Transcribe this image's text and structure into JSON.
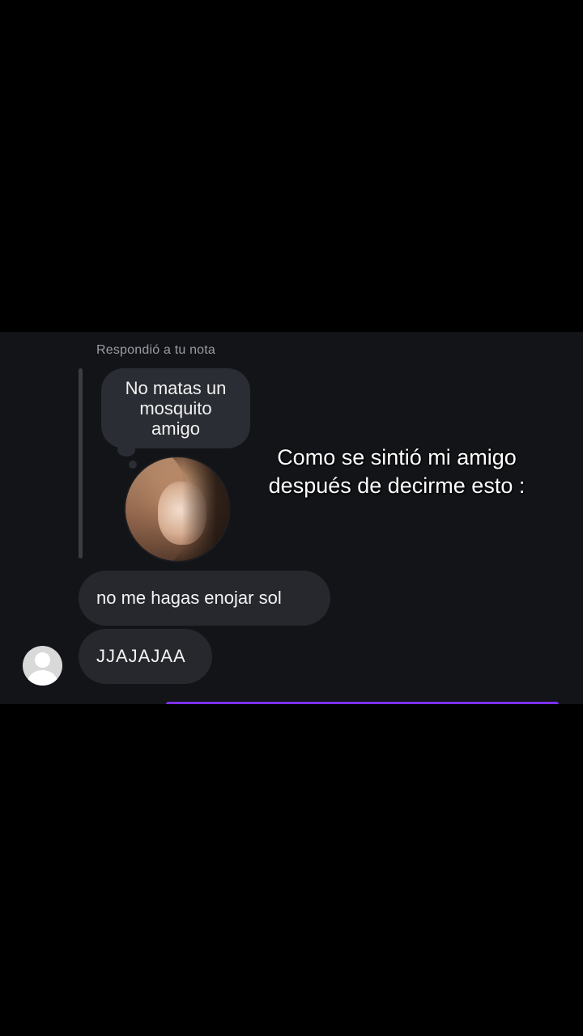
{
  "chat": {
    "reply_label": "Respondió a tu nota",
    "note_text": "No matas un\nmosquito\namigo",
    "messages": [
      {
        "text": "no me hagas enojar sol"
      },
      {
        "text": "JJAJAJAA"
      }
    ]
  },
  "overlay": {
    "caption": "Como se sintió mi amigo\ndespués de decirme esto :"
  },
  "colors": {
    "background": "#000000",
    "chat_background": "#121418",
    "bubble": "#26282d",
    "accent": "#7b2ff2",
    "text": "#f3f3f3",
    "muted_text": "#9a9ca3"
  },
  "icons": {
    "sender_avatar": "default-user-avatar-icon",
    "note_avatar": "profile-photo"
  }
}
